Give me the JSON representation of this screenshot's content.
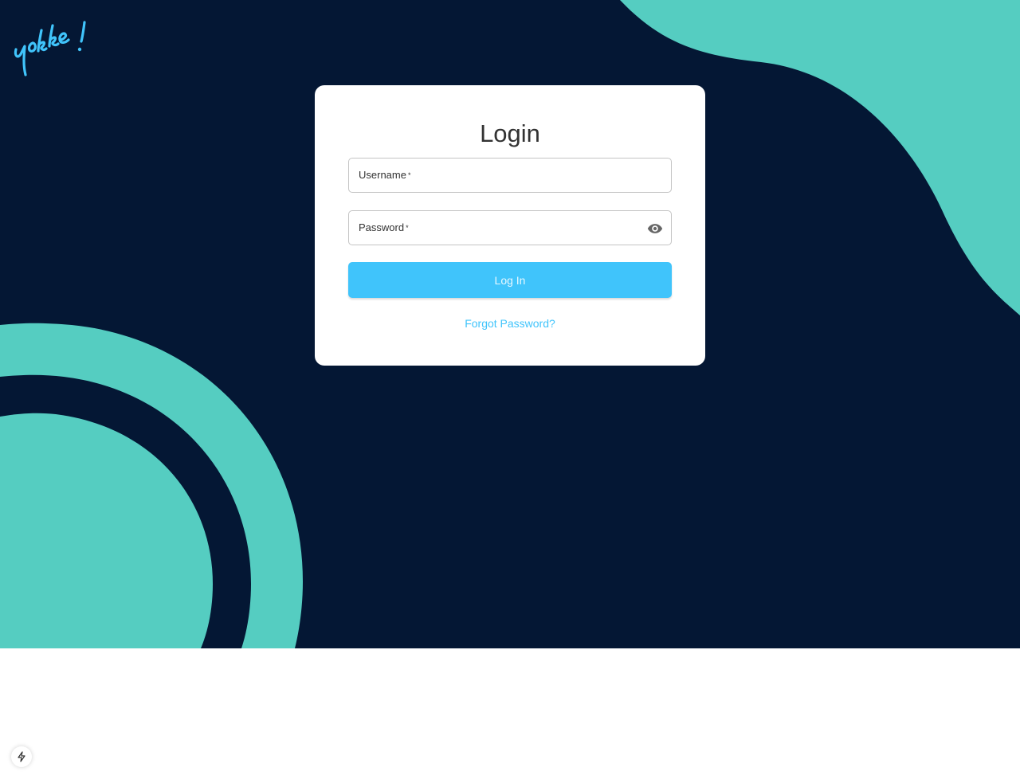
{
  "brand": {
    "logo_text": "yokke!",
    "logo_color": "#40c4fb"
  },
  "colors": {
    "background": "#041734",
    "accent_shape": "#55cdc1",
    "primary": "#40c4fb"
  },
  "login_card": {
    "title": "Login",
    "username": {
      "label": "Username",
      "required_mark": "*",
      "value": ""
    },
    "password": {
      "label": "Password",
      "required_mark": "*",
      "value": "",
      "toggle_icon": "eye-icon"
    },
    "submit_label": "Log In",
    "forgot_link": "Forgot Password?"
  },
  "dev_indicator": {
    "icon": "lightning-bolt-icon"
  }
}
